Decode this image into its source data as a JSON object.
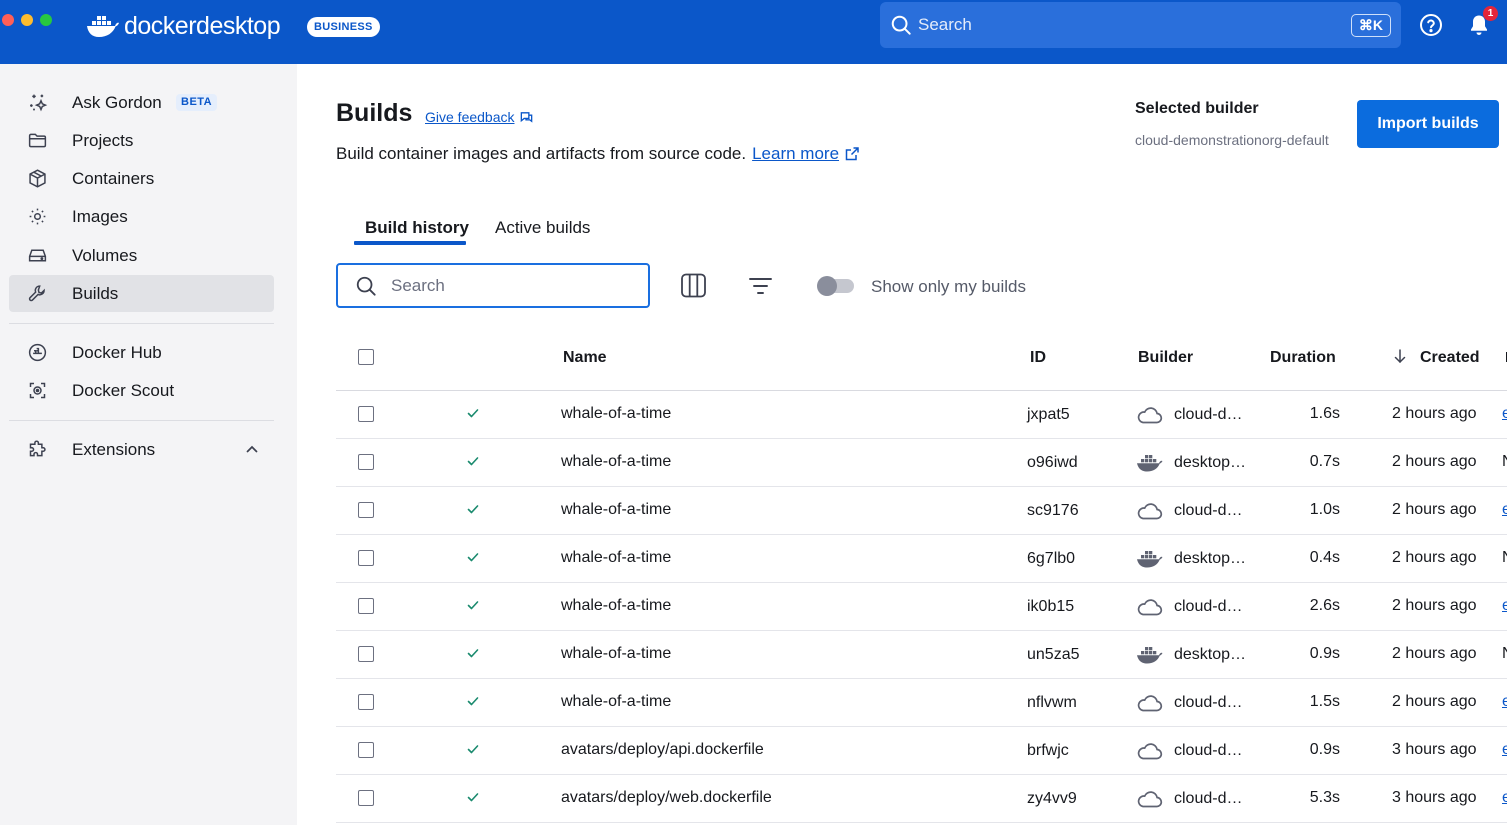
{
  "app": {
    "brand_prefix": "docker",
    "brand_suffix": "desktop",
    "plan_badge": "BUSINESS",
    "search_placeholder": "Search",
    "search_shortcut": "⌘K",
    "notification_count": "1"
  },
  "sidebar": {
    "items": [
      {
        "label": "Ask Gordon",
        "icon": "sparkle-icon",
        "badge": "BETA"
      },
      {
        "label": "Projects",
        "icon": "folder-icon"
      },
      {
        "label": "Containers",
        "icon": "container-cube-icon"
      },
      {
        "label": "Images",
        "icon": "image-layers-icon"
      },
      {
        "label": "Volumes",
        "icon": "volume-drive-icon"
      },
      {
        "label": "Builds",
        "icon": "wrench-icon",
        "active": true
      },
      {
        "label": "Docker Hub",
        "icon": "docker-hub-icon"
      },
      {
        "label": "Docker Scout",
        "icon": "docker-scout-icon"
      },
      {
        "label": "Extensions",
        "icon": "puzzle-icon"
      }
    ]
  },
  "page": {
    "title": "Builds",
    "feedback_link": "Give feedback",
    "subtitle": "Build container images and artifacts from source code.",
    "learn_more": "Learn more",
    "selected_builder_label": "Selected builder",
    "selected_builder_value": "cloud-demonstrationorg-default",
    "import_button": "Import builds",
    "tabs": [
      {
        "label": "Build history",
        "active": true
      },
      {
        "label": "Active builds",
        "active": false
      }
    ],
    "search_placeholder": "Search",
    "toggle_label": "Show only my builds"
  },
  "table": {
    "columns": [
      "Name",
      "ID",
      "Builder",
      "Duration",
      "Created"
    ],
    "rows": [
      {
        "name": "whale-of-a-time",
        "id": "jxpat5",
        "builder": "cloud-d…",
        "builder_type": "cloud",
        "duration": "1.6s",
        "created": "2 hours ago",
        "edge": "e"
      },
      {
        "name": "whale-of-a-time",
        "id": "o96iwd",
        "builder": "desktop…",
        "builder_type": "docker",
        "duration": "0.7s",
        "created": "2 hours ago",
        "edge": "N"
      },
      {
        "name": "whale-of-a-time",
        "id": "sc9176",
        "builder": "cloud-d…",
        "builder_type": "cloud",
        "duration": "1.0s",
        "created": "2 hours ago",
        "edge": "e"
      },
      {
        "name": "whale-of-a-time",
        "id": "6g7lb0",
        "builder": "desktop…",
        "builder_type": "docker",
        "duration": "0.4s",
        "created": "2 hours ago",
        "edge": "N"
      },
      {
        "name": "whale-of-a-time",
        "id": "ik0b15",
        "builder": "cloud-d…",
        "builder_type": "cloud",
        "duration": "2.6s",
        "created": "2 hours ago",
        "edge": "e"
      },
      {
        "name": "whale-of-a-time",
        "id": "un5za5",
        "builder": "desktop…",
        "builder_type": "docker",
        "duration": "0.9s",
        "created": "2 hours ago",
        "edge": "N"
      },
      {
        "name": "whale-of-a-time",
        "id": "nflvwm",
        "builder": "cloud-d…",
        "builder_type": "cloud",
        "duration": "1.5s",
        "created": "2 hours ago",
        "edge": "e"
      },
      {
        "name": "avatars/deploy/api.dockerfile",
        "id": "brfwjc",
        "builder": "cloud-d…",
        "builder_type": "cloud",
        "duration": "0.9s",
        "created": "3 hours ago",
        "edge": "e"
      },
      {
        "name": "avatars/deploy/web.dockerfile",
        "id": "zy4vv9",
        "builder": "cloud-d…",
        "builder_type": "cloud",
        "duration": "5.3s",
        "created": "3 hours ago",
        "edge": "e"
      }
    ]
  },
  "colors": {
    "brand_blue": "#0b57c9",
    "button_blue": "#0b6cde",
    "success_green": "#1a8a6e",
    "sidebar_bg": "#f4f4f6"
  }
}
